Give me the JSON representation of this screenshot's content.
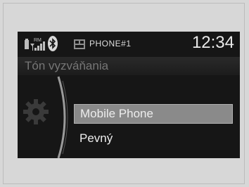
{
  "status": {
    "phone_name": "PHONE#1",
    "time": "12:34",
    "signal_label": "RM"
  },
  "menu": {
    "title": "Tón vyzváňania",
    "items": [
      {
        "label": "Mobile Phone",
        "selected": true
      },
      {
        "label": "Pevný",
        "selected": false
      }
    ]
  },
  "icons": {
    "battery": "battery-icon",
    "signal": "signal-strength-icon",
    "bluetooth": "bluetooth-icon",
    "phone_card": "phone-card-icon",
    "settings": "gear-icon"
  },
  "colors": {
    "screen_bg": "#161616",
    "highlight": "#8a8a8a",
    "text": "#ededed"
  }
}
